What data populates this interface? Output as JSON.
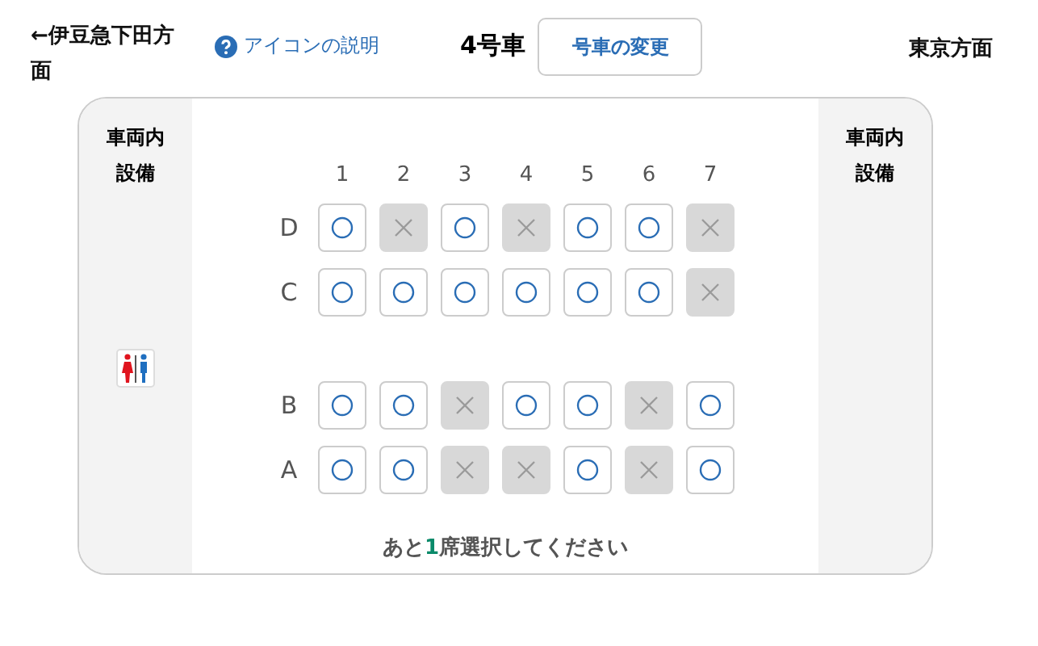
{
  "header": {
    "left_direction": "←伊豆急下田方面",
    "help_link": "アイコンの説明",
    "car": "4号車",
    "change_button": "号車の変更",
    "right_direction": "東京方面"
  },
  "side_left": {
    "title": "車両内設備"
  },
  "side_right": {
    "title": "車両内設備"
  },
  "columns": [
    "1",
    "2",
    "3",
    "4",
    "5",
    "6",
    "7"
  ],
  "seat_groups": [
    {
      "rows": [
        {
          "label": "D",
          "seats": [
            {
              "available": true
            },
            {
              "available": false
            },
            {
              "available": true
            },
            {
              "available": false
            },
            {
              "available": true
            },
            {
              "available": true
            },
            {
              "available": false
            }
          ]
        },
        {
          "label": "C",
          "seats": [
            {
              "available": true
            },
            {
              "available": true
            },
            {
              "available": true
            },
            {
              "available": true
            },
            {
              "available": true
            },
            {
              "available": true
            },
            {
              "available": false
            }
          ]
        }
      ]
    },
    {
      "rows": [
        {
          "label": "B",
          "seats": [
            {
              "available": true
            },
            {
              "available": true
            },
            {
              "available": false
            },
            {
              "available": true
            },
            {
              "available": true
            },
            {
              "available": false
            },
            {
              "available": true
            }
          ]
        },
        {
          "label": "A",
          "seats": [
            {
              "available": true
            },
            {
              "available": true
            },
            {
              "available": false
            },
            {
              "available": false
            },
            {
              "available": true
            },
            {
              "available": false
            },
            {
              "available": true
            }
          ]
        }
      ]
    }
  ],
  "prompt": {
    "before": "あと",
    "count": "1",
    "after": "席選択してください"
  }
}
